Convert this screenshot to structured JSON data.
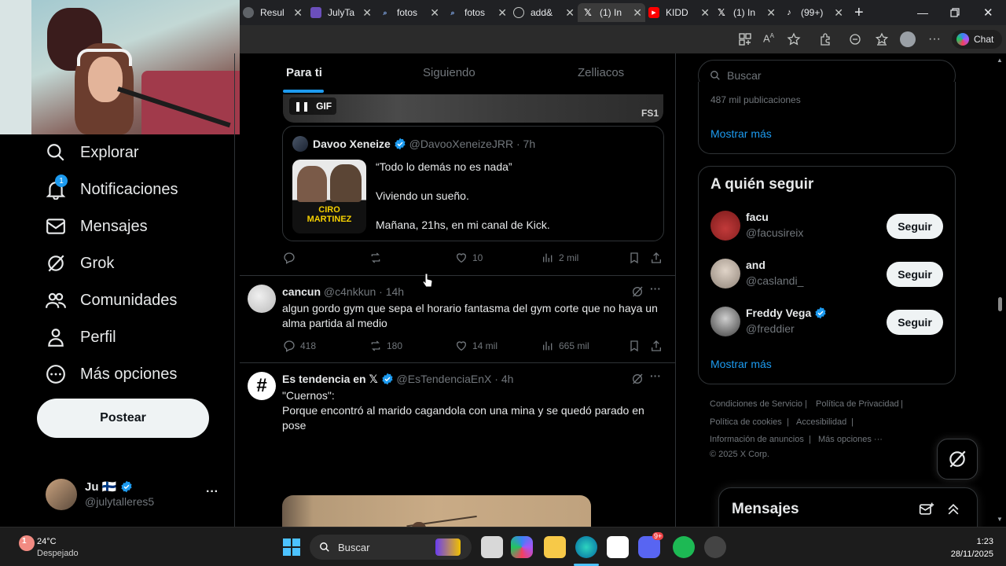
{
  "browser": {
    "tabs": [
      {
        "label": "Resul",
        "color": "#5f6368"
      },
      {
        "label": "JulyTa",
        "color": "#6b4fbb"
      },
      {
        "label": "fotos",
        "color": "#202124"
      },
      {
        "label": "fotos",
        "color": "#202124"
      },
      {
        "label": "add&",
        "color": "#202124"
      },
      {
        "label": "(1) In",
        "color": "#000000"
      },
      {
        "label": "KIDD",
        "color": "#ff0000"
      },
      {
        "label": "(1) In",
        "color": "#000000"
      },
      {
        "label": "(99+)",
        "color": "#000000"
      }
    ],
    "chat_label": "Chat"
  },
  "nav": {
    "items": [
      {
        "label": "Explorar",
        "icon": "search-icon"
      },
      {
        "label": "Notificaciones",
        "icon": "bell-icon",
        "badge": "1"
      },
      {
        "label": "Mensajes",
        "icon": "mail-icon"
      },
      {
        "label": "Grok",
        "icon": "grok-icon"
      },
      {
        "label": "Comunidades",
        "icon": "people-icon"
      },
      {
        "label": "Perfil",
        "icon": "person-icon"
      },
      {
        "label": "Más opciones",
        "icon": "more-circle-icon"
      }
    ],
    "post_label": "Postear",
    "account": {
      "name": "Ju 🇫🇮",
      "handle": "@julytalleres5"
    }
  },
  "feed": {
    "tabs": [
      "Para ti",
      "Siguiendo",
      "Zelliacos"
    ],
    "gif_label": "GIF",
    "gif_watermark": "FS1",
    "quoted": {
      "name": "Davoo Xeneize",
      "handle": "@DavooXeneizeJRR · 7h",
      "line1": "“Todo lo demás no es nada”",
      "line2": "Viviendo un sueño.",
      "line3": "Mañana, 21hs, en mi canal de Kick.",
      "thumb_text": "CIRO MARTINEZ"
    },
    "post1_actions": {
      "reply": "",
      "repost": "",
      "likes": "10",
      "views": "2 mil"
    },
    "post2": {
      "name": "cancun",
      "handle": "@c4nkkun · 14h",
      "text": "algun gordo gym que sepa el horario fantasma del gym corte que no haya un alma partida al medio",
      "reply": "418",
      "repost": "180",
      "likes": "14 mil",
      "views": "665 mil"
    },
    "post3": {
      "name": "Es tendencia en 𝕏",
      "handle": "@EsTendenciaEnX · 4h",
      "line1": "\"Cuernos\":",
      "line2": "Porque encontró al marido cagandola con una mina y se quedó parado en pose"
    }
  },
  "right": {
    "search_placeholder": "Buscar",
    "trend_count": "487 mil publicaciones",
    "show_more": "Mostrar más",
    "who_to_follow_title": "A quién seguir",
    "suggestions": [
      {
        "name": "facu",
        "handle": "@facusireix",
        "button": "Seguir",
        "verified": false
      },
      {
        "name": "and",
        "handle": "@caslandi_",
        "button": "Seguir",
        "verified": false
      },
      {
        "name": "Freddy Vega",
        "handle": "@freddier",
        "button": "Seguir",
        "verified": true
      }
    ],
    "footer": {
      "terms": "Condiciones de Servicio",
      "privacy": "Política de Privacidad",
      "cookies": "Política de cookies",
      "accessibility": "Accesibilidad",
      "ads": "Información de anuncios",
      "more": "Más opciones ···",
      "copyright": "© 2025 X Corp."
    },
    "messages_title": "Mensajes"
  },
  "taskbar": {
    "temp": "24°C",
    "weather": "Despejado",
    "search_placeholder": "Buscar",
    "time": "1:23",
    "date": "28/11/2025",
    "weather_badge": "1",
    "discord_badge": "9+"
  },
  "colors": {
    "accent": "#1d9bf0",
    "background": "#000000",
    "text": "#e7e9ea",
    "muted": "#71767b"
  }
}
